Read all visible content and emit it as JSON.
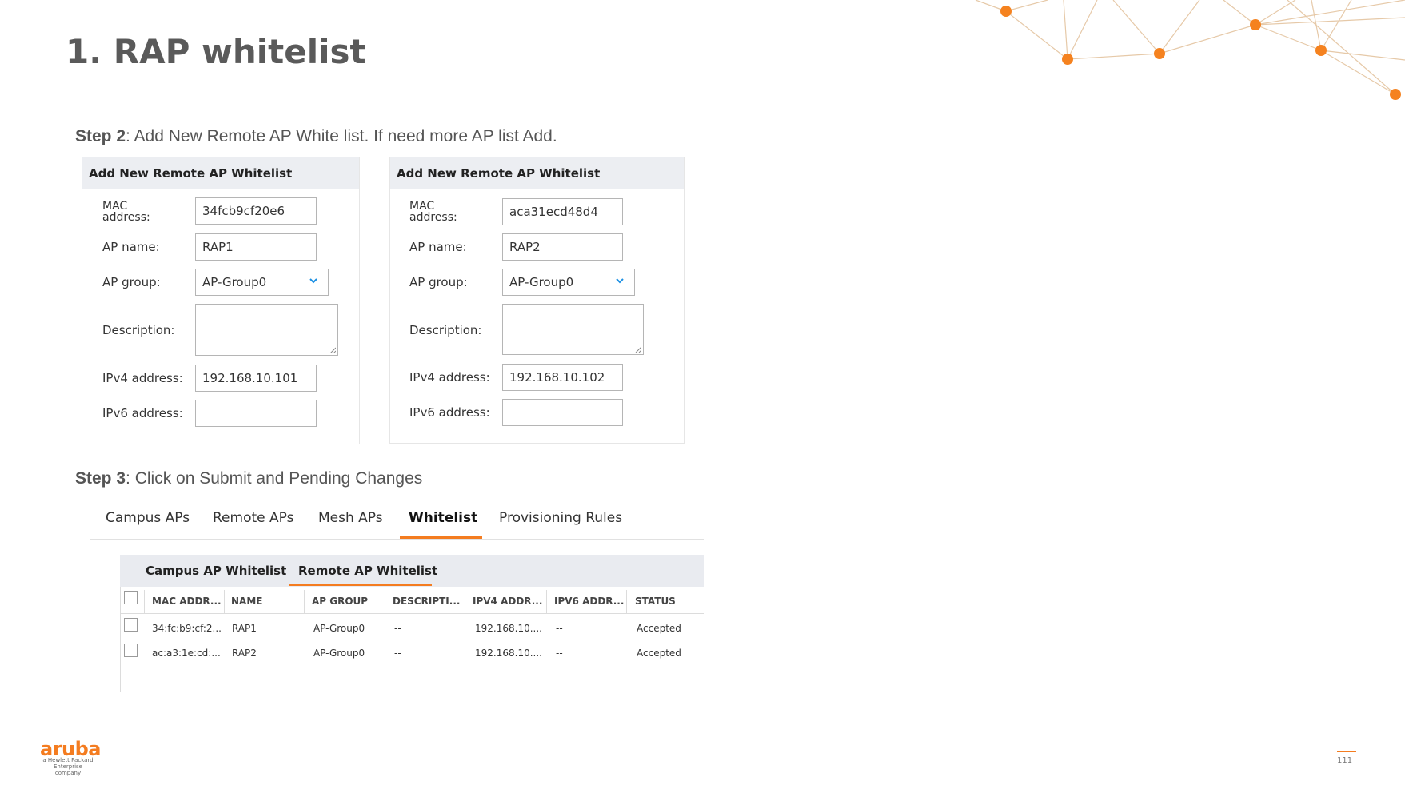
{
  "slide": {
    "title": "1. RAP whitelist",
    "step2_bold": "Step 2",
    "step2_text": ": Add New Remote AP White list. If need more AP list Add.",
    "step3_bold": "Step 3",
    "step3_text": ": Click on Submit and Pending Changes",
    "page_number": "111",
    "brand": {
      "name": "aruba",
      "tagline_line1": "a Hewlett Packard",
      "tagline_line2": "Enterprise company"
    }
  },
  "forms": [
    {
      "header": "Add New Remote AP Whitelist",
      "labels": {
        "mac_line1": "MAC",
        "mac_line2": "address:",
        "ap_name": "AP name:",
        "ap_group": "AP group:",
        "description": "Description:",
        "ipv4": "IPv4 address:",
        "ipv6": "IPv6 address:"
      },
      "values": {
        "mac": "34fcb9cf20e6",
        "ap_name": "RAP1",
        "ap_group": "AP-Group0",
        "description": "",
        "ipv4": "192.168.10.101",
        "ipv6": ""
      }
    },
    {
      "header": "Add New Remote AP Whitelist",
      "labels": {
        "mac_line1": "MAC",
        "mac_line2": "address:",
        "ap_name": "AP name:",
        "ap_group": "AP group:",
        "description": "Description:",
        "ipv4": "IPv4 address:",
        "ipv6": "IPv6 address:"
      },
      "values": {
        "mac": "aca31ecd48d4",
        "ap_name": "RAP2",
        "ap_group": "AP-Group0",
        "description": "",
        "ipv4": "192.168.10.102",
        "ipv6": ""
      }
    }
  ],
  "tabs": [
    "Campus APs",
    "Remote APs",
    "Mesh APs",
    "Whitelist",
    "Provisioning Rules"
  ],
  "active_tab": "Whitelist",
  "subtabs": [
    "Campus AP Whitelist",
    "Remote AP Whitelist"
  ],
  "active_subtab": "Remote AP Whitelist",
  "table": {
    "headers": [
      "MAC ADDR...",
      "NAME",
      "AP GROUP",
      "DESCRIPTI...",
      "IPV4 ADDR...",
      "IPV6 ADDR...",
      "STATUS"
    ],
    "rows": [
      [
        "34:fc:b9:cf:2...",
        "RAP1",
        "AP-Group0",
        "--",
        "192.168.10....",
        "--",
        "Accepted"
      ],
      [
        "ac:a3:1e:cd:...",
        "RAP2",
        "AP-Group0",
        "--",
        "192.168.10....",
        "--",
        "Accepted"
      ]
    ]
  },
  "colors": {
    "accent": "#f47c20",
    "network_node": "#f5821f",
    "network_line": "#e6c9a8",
    "dropdown_chevron": "#1b8fe3"
  },
  "icons": {
    "dropdown": "chevron-down-icon",
    "checkbox": "checkbox-icon",
    "resize": "resize-grip-icon"
  }
}
